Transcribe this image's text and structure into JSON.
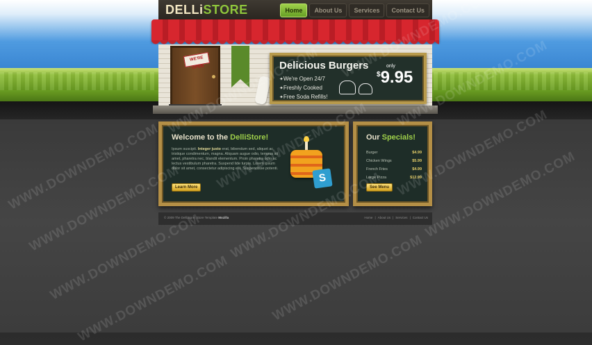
{
  "header": {
    "logo_part1": "DELLi",
    "logo_part2": "STORE",
    "nav": [
      "Home",
      "About Us",
      "Services",
      "Contact Us"
    ],
    "active_index": 0
  },
  "storefront": {
    "door_sign": "WE'RE OPEN"
  },
  "board": {
    "title": "Delicious Burgers",
    "features": [
      "We're Open 24/7",
      "Freshly Cooked",
      "Free Soda Refills!"
    ],
    "only": "only",
    "price_dollar": "$",
    "price": "9.95"
  },
  "welcome": {
    "title_prefix": "Welcome to the ",
    "title_highlight": "DelliStore!",
    "text_lead": "Ipsum suscipit. ",
    "text_bold": "Integer justo",
    "text_body": " erat, bibendum sed, aliquet ac, tristique condimentum, magna. Aliquam augue odio, tempus sit amet, pharetra nec, blandit elementum. Proin pharetra odio ac lectus vestibulum pharetra. Suspend lide turpis. Lorem ipsum dolor sit amet, consectetur adipiscing elit. Suspendisse potenti.",
    "button": "Learn More",
    "badge_letter": "S"
  },
  "specials": {
    "title_prefix": "Our ",
    "title_highlight": "Specials!",
    "items": [
      {
        "name": "Burger",
        "price": "$4.99"
      },
      {
        "name": "Chicken Wings",
        "price": "$5.99"
      },
      {
        "name": "French Fries",
        "price": "$4.99"
      },
      {
        "name": "Large Pizza",
        "price": "$12.99"
      }
    ],
    "button": "See Menu"
  },
  "footer": {
    "copyright": "© 2009 The DelliStore. Store Template",
    "brand": "Mozilla",
    "links": [
      "Home",
      "|",
      "About Us",
      "|",
      "Services",
      "|",
      "Contact Us"
    ]
  },
  "watermark": "WWW.DOWNDEMO.COM"
}
